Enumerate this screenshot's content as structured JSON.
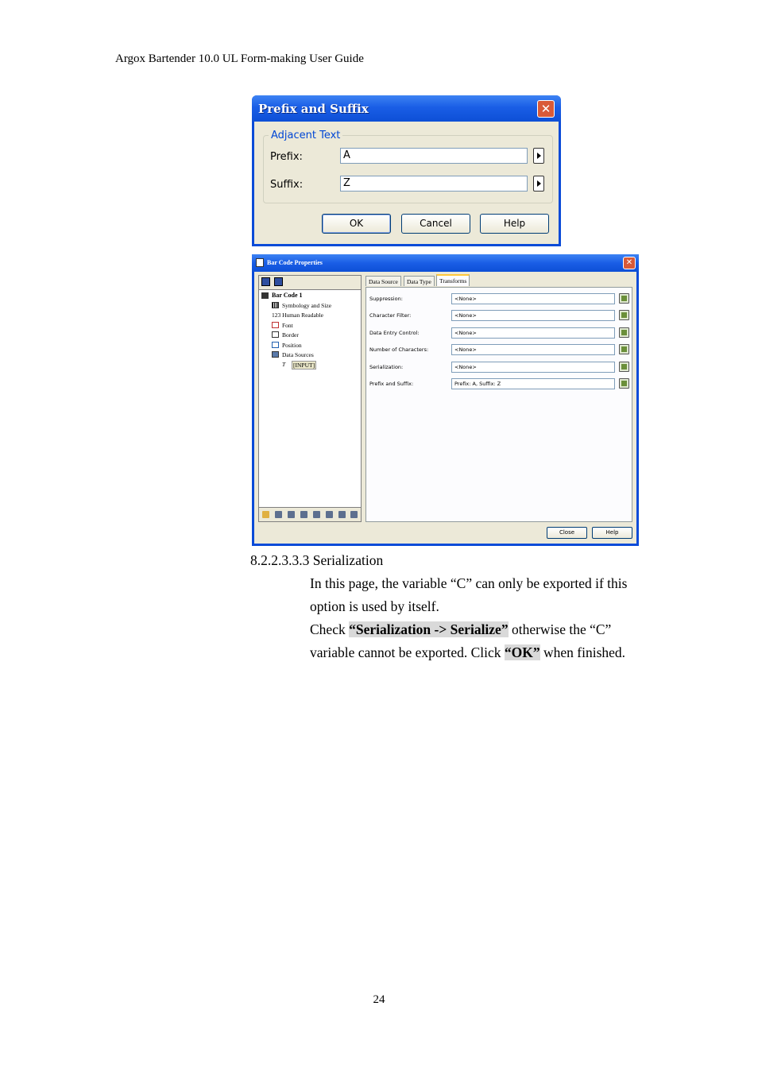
{
  "header": "Argox Bartender 10.0 UL Form-making User Guide",
  "prefix_dialog": {
    "title": "Prefix and Suffix",
    "group": "Adjacent Text",
    "prefix_label": "Prefix:",
    "prefix_value": "A",
    "suffix_label": "Suffix:",
    "suffix_value": "Z",
    "ok": "OK",
    "cancel": "Cancel",
    "help": "Help"
  },
  "barcode_dialog": {
    "title": "Bar Code Properties",
    "tree": [
      "Bar Code 1",
      "Symbology and Size",
      "123 Human Readable",
      "Font",
      "Border",
      "Position",
      "Data Sources",
      "[INPUT]"
    ],
    "tabs": [
      "Data Source",
      "Data Type",
      "Transforms"
    ],
    "rows": [
      {
        "label": "Suppression:",
        "value": "<None>"
      },
      {
        "label": "Character Filter:",
        "value": "<None>"
      },
      {
        "label": "Data Entry Control:",
        "value": "<None>"
      },
      {
        "label": "Number of Characters:",
        "value": "<None>"
      },
      {
        "label": "Serialization:",
        "value": "<None>"
      },
      {
        "label": "Prefix and Suffix:",
        "value": "Prefix: A, Suffix: Z"
      }
    ],
    "close": "Close",
    "help": "Help"
  },
  "section_title": "8.2.2.3.3.3  Serialization",
  "para1": "In this page, the variable “C” can only be exported if this option is used by itself.",
  "para2": {
    "p1": "Check ",
    "b1": "“Serialization -> Serialize”",
    "p2": " otherwise the “C” variable cannot be exported. Click ",
    "b2": "“OK”",
    "p3": " when finished."
  },
  "page_number": "24"
}
